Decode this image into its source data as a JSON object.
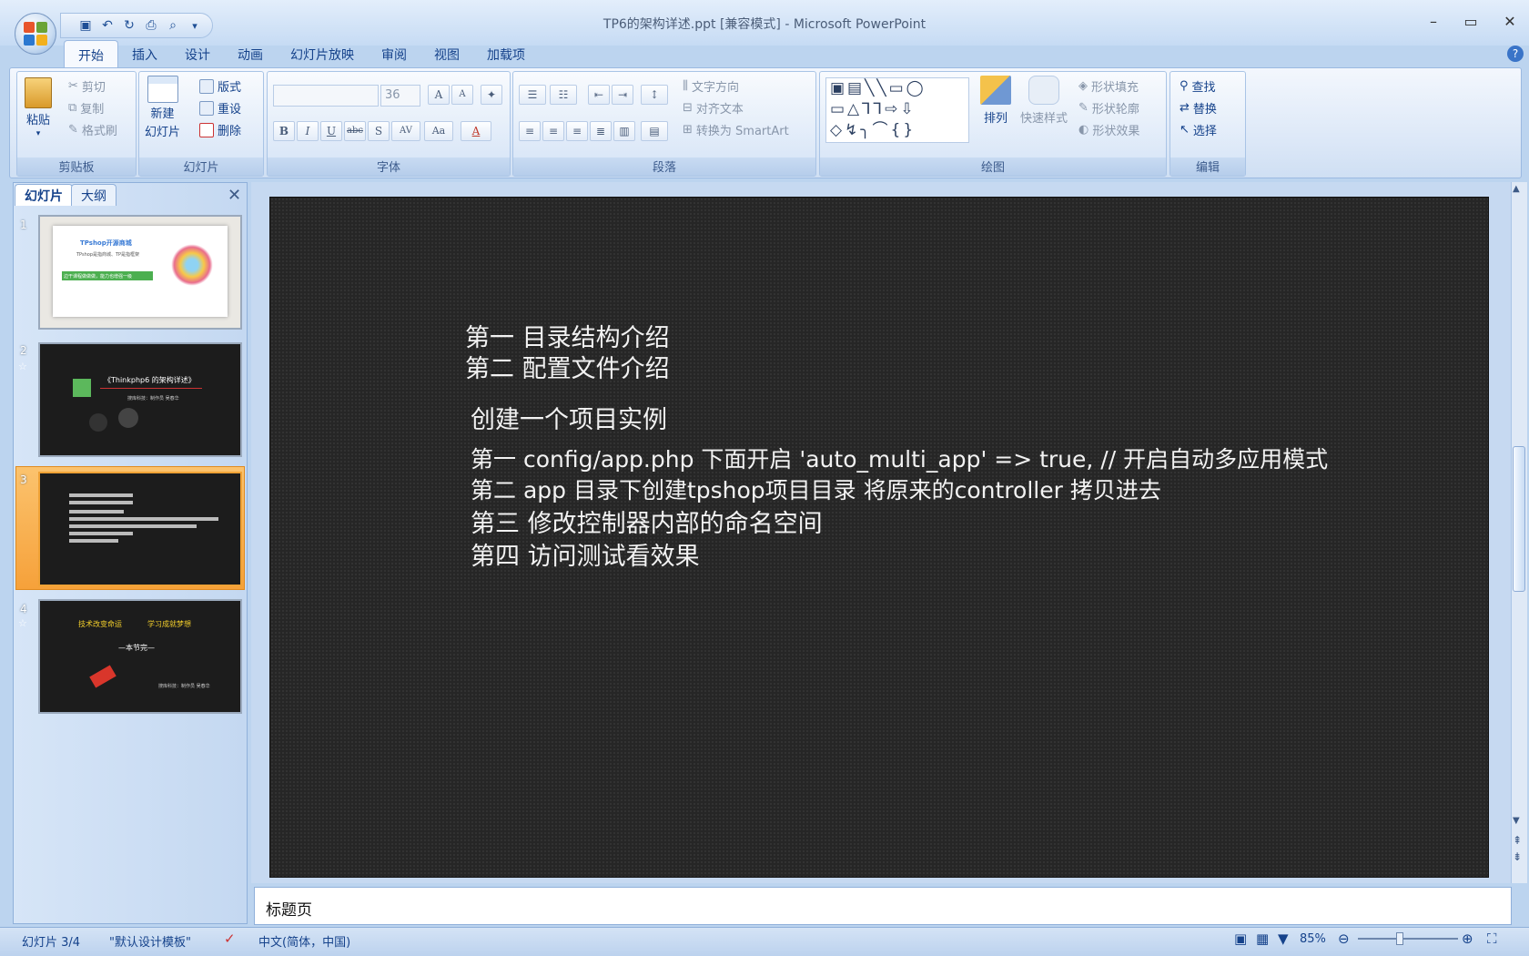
{
  "window": {
    "title": "TP6的架构详述.ppt [兼容模式] - Microsoft PowerPoint"
  },
  "qat": {
    "customize": "▾"
  },
  "tabs": [
    "开始",
    "插入",
    "设计",
    "动画",
    "幻灯片放映",
    "审阅",
    "视图",
    "加载项"
  ],
  "ribbon": {
    "clipboard": {
      "paste": "粘贴",
      "cut": "剪切",
      "copy": "复制",
      "format_painter": "格式刷",
      "caption": "剪贴板"
    },
    "slides": {
      "new_slide": "新建",
      "new_slide2": "幻灯片",
      "layout": "版式",
      "reset": "重设",
      "delete": "删除",
      "caption": "幻灯片"
    },
    "font": {
      "size": "36",
      "caption": "字体"
    },
    "paragraph": {
      "text_direction": "文字方向",
      "align_text": "对齐文本",
      "smartart": "转换为 SmartArt",
      "caption": "段落"
    },
    "drawing": {
      "arrange": "排列",
      "quick_styles": "快速样式",
      "shape_fill": "形状填充",
      "shape_outline": "形状轮廓",
      "shape_effects": "形状效果",
      "caption": "绘图"
    },
    "editing": {
      "find": "查找",
      "replace": "替换",
      "select": "选择",
      "caption": "编辑"
    }
  },
  "left_pane": {
    "tab_slides": "幻灯片",
    "tab_outline": "大纲",
    "slides": [
      {
        "num": "1",
        "title": "TPshop开源商城",
        "subtitle": "TPshop是指商城、TP是指框架",
        "banner": "边干课程做做做，能力也增强一级"
      },
      {
        "num": "2",
        "title": "《Thinkphp6 的架构详述》",
        "byline": "搜库科技：制作员 吴春华"
      },
      {
        "num": "3"
      },
      {
        "num": "4",
        "line1": "技术改变命运",
        "line2": "学习成就梦想",
        "line3": "—本节完—",
        "byline": "搜库科技：制作员 吴春华"
      }
    ]
  },
  "slide": {
    "lines": [
      "第一 目录结构介绍",
      "第二 配置文件介绍",
      "创建一个项目实例",
      "第一 config/app.php 下面开启  'auto_multi_app' => true, // 开启自动多应用模式",
      "第二 app 目录下创建tpshop项目目录 将原来的controller 拷贝进去",
      "第三 修改控制器内部的命名空间",
      "第四  访问测试看效果"
    ]
  },
  "notes": {
    "text": "标题页"
  },
  "status": {
    "slide_pos": "幻灯片 3/4",
    "theme": "\"默认设计模板\"",
    "language": "中文(简体，中国)",
    "zoom": "85%"
  },
  "colors": {
    "ribbon_bg": "#dbe7f7",
    "accent_orange": "#f6a13a",
    "slide_bg": "#262626"
  }
}
